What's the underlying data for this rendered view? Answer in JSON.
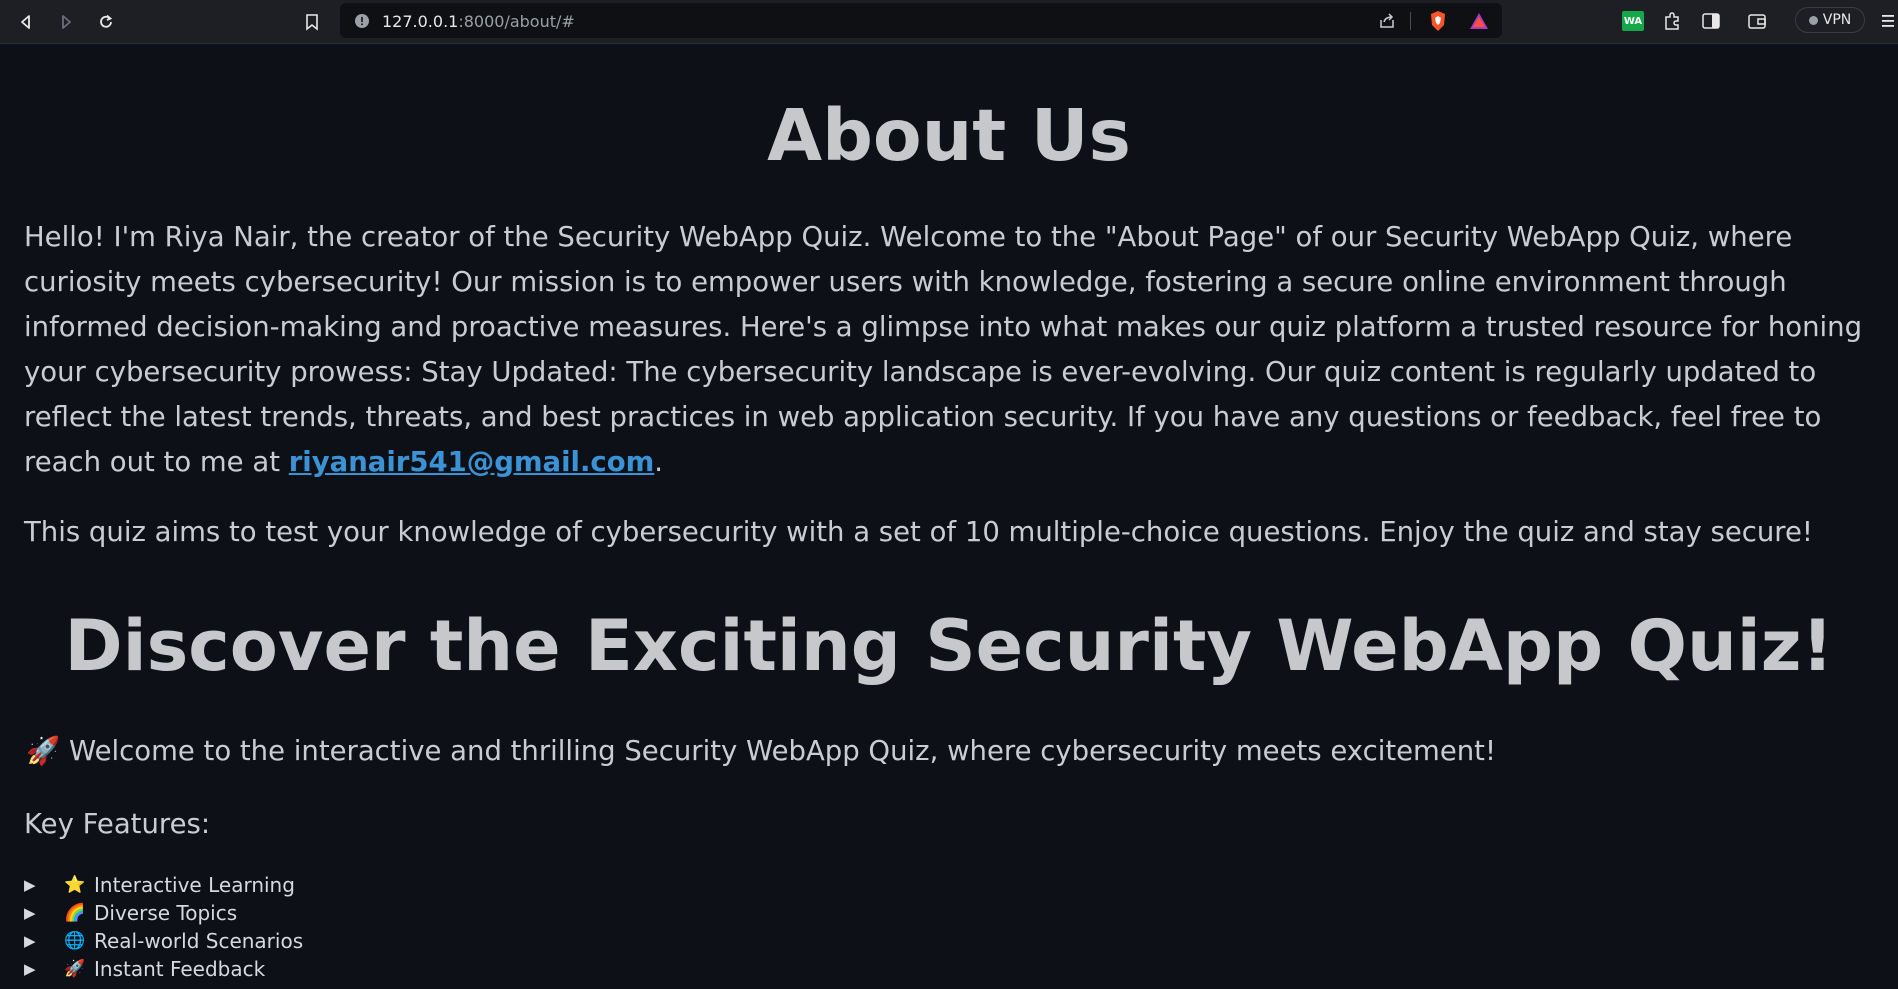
{
  "browser": {
    "url_host": "127.0.0.1",
    "url_path": ":8000/about/#",
    "vpn_label": "VPN",
    "wa_label": "WA"
  },
  "page": {
    "title": "About Us",
    "para1_text": "Hello! I'm Riya Nair, the creator of the Security WebApp Quiz. Welcome to the \"About Page\" of our Security WebApp Quiz, where curiosity meets cybersecurity! Our mission is to empower users with knowledge, fostering a secure online environment through informed decision-making and proactive measures. Here's a glimpse into what makes our quiz platform a trusted resource for honing your cybersecurity prowess: Stay Updated: The cybersecurity landscape is ever-evolving. Our quiz content is regularly updated to reflect the latest trends, threats, and best practices in web application security. If you have any questions or feedback, feel free to reach out to me at ",
    "email": "riyanair541@gmail.com",
    "para1_end": ".",
    "para2": "This quiz aims to test your knowledge of cybersecurity with a set of 10 multiple-choice questions. Enjoy the quiz and stay secure!",
    "discover_title": "Discover the Exciting Security WebApp Quiz!",
    "welcome_emoji": "🚀",
    "welcome_text": "Welcome to the interactive and thrilling Security WebApp Quiz, where cybersecurity meets excitement!",
    "key_features_label": "Key Features:",
    "features": [
      {
        "marker": "▶",
        "emoji": "⭐",
        "label": "Interactive Learning"
      },
      {
        "marker": "▶",
        "emoji": "🌈",
        "label": "Diverse Topics"
      },
      {
        "marker": "▶",
        "emoji": "🌐",
        "label": "Real-world Scenarios"
      },
      {
        "marker": "▶",
        "emoji": "🚀",
        "label": "Instant Feedback"
      }
    ]
  },
  "colors": {
    "background": "#0d1117",
    "text": "#c9cdd3",
    "link": "#3b93d6",
    "chrome": "#1e1f24"
  }
}
